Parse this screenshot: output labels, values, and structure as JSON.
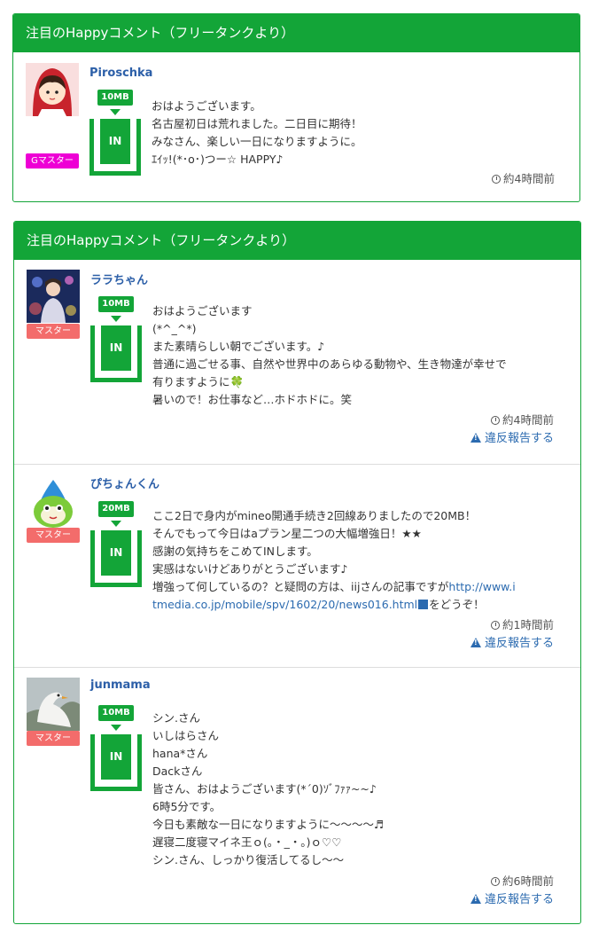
{
  "panels": [
    {
      "title": "注目のHappyコメント（フリータンクより）",
      "entries": [
        {
          "username": "Piroschka",
          "badge": "Gマスター",
          "mb": "10MB",
          "in_label": "IN",
          "message": [
            "おはようございます。",
            "名古屋初日は荒れました。二日目に期待！",
            "みなさん、楽しい一日になりますように。",
            "ｴｲｯ!(*･o･)つー☆ HAPPY♪"
          ],
          "time": "約4時間前",
          "avatar": "red-hood-avatar"
        }
      ]
    },
    {
      "title": "注目のHappyコメント（フリータンクより）",
      "entries": [
        {
          "username": "ララちゃん",
          "badge": "マスター",
          "mb": "10MB",
          "in_label": "IN",
          "message": [
            "おはようございます",
            "(*^_^*)",
            "また素晴らしい朝でございます。♪",
            "普通に過ごせる事、自然や世界中のあらゆる動物や、生き物達が幸せで",
            "有りますように🍀",
            "暑いので！お仕事など…ホドホドに。笑"
          ],
          "time": "約4時間前",
          "report": "違反報告する",
          "avatar": "night-photo-avatar"
        },
        {
          "username": "ぴちょんくん",
          "badge": "マスター",
          "mb": "20MB",
          "in_label": "IN",
          "message": [
            "ここ2日で身内がmineo開通手続き2回線ありましたので20MB！",
            "そんでもって今日はaプラン星二つの大幅増強日！★★",
            "感謝の気持ちをこめてINします。",
            "実感はないけどありがとうございます♪"
          ],
          "message_link_prefix": "増強って何しているの？と疑問の方は、iijさんの記事ですが",
          "message_link_line1": "http://www.i",
          "message_link_line2": "tmedia.co.jp/mobile/spv/1602/20/news016.html",
          "message_link_suffix": "をどうぞ！",
          "time": "約1時間前",
          "report": "違反報告する",
          "avatar": "drop-character-avatar"
        },
        {
          "username": "junmama",
          "badge": "マスター",
          "mb": "10MB",
          "in_label": "IN",
          "message": [
            "シン.さん",
            "いしはらさん",
            "hana*さん",
            "Dackさん",
            "皆さん、おはようございます(*´0)ｿﾞﾌｧｧ~~♪",
            "6時5分です。",
            "今日も素敵な一日になりますように〜〜〜〜♬",
            "遅寝二度寝マイネ王ｏ(｡・_・｡)ｏ♡♡",
            "シン.さん、しっかり復活してるし〜〜"
          ],
          "time": "約6時間前",
          "report": "違反報告する",
          "avatar": "swan-photo-avatar"
        }
      ]
    }
  ]
}
